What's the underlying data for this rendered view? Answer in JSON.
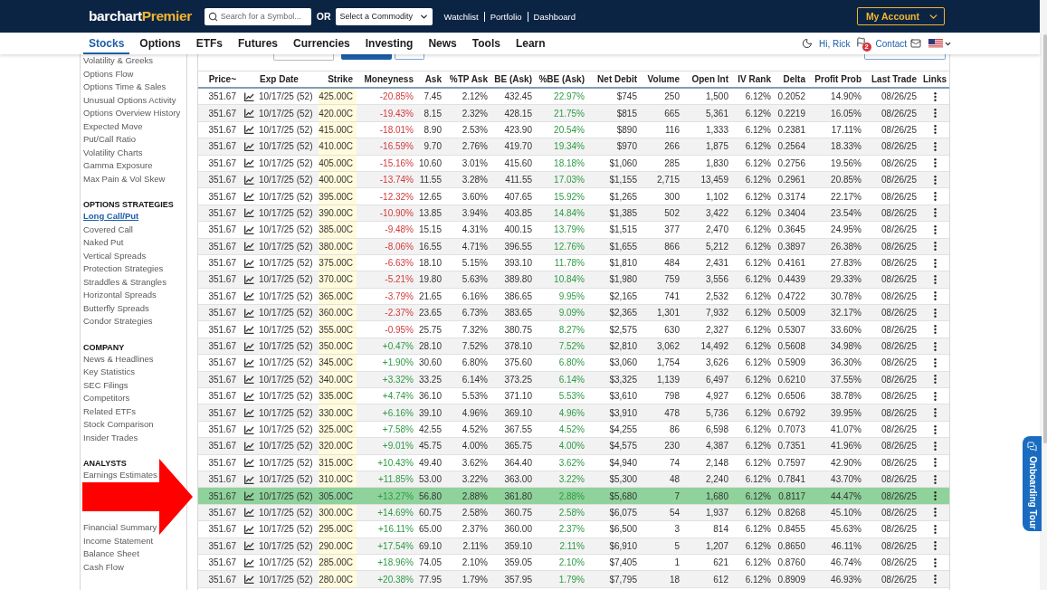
{
  "header": {
    "logo": {
      "brand": "barchart",
      "tier": "Premier"
    },
    "search": {
      "placeholder": "Search for a Symbol..."
    },
    "or_label": "OR",
    "commodity_select": {
      "value": "Select a Commodity"
    },
    "links": [
      "Watchlist",
      "Portfolio",
      "Dashboard"
    ],
    "account_button": "My Account"
  },
  "nav": {
    "tabs": [
      {
        "label": "Stocks",
        "selected": true
      },
      {
        "label": "Options",
        "selected": false
      },
      {
        "label": "ETFs",
        "selected": false
      },
      {
        "label": "Futures",
        "selected": false
      },
      {
        "label": "Currencies",
        "selected": false
      },
      {
        "label": "Investing",
        "selected": false
      },
      {
        "label": "News",
        "selected": false
      },
      {
        "label": "Tools",
        "selected": false
      },
      {
        "label": "Learn",
        "selected": false
      }
    ],
    "greeting": "Hi, Rick",
    "notification_count": "2",
    "contact": "Contact"
  },
  "sidebar": {
    "sections": [
      {
        "items": [
          {
            "kind": "link",
            "label": "Volatility & Greeks",
            "selected": false
          },
          {
            "kind": "link",
            "label": "Options Flow",
            "selected": false
          },
          {
            "kind": "link",
            "label": "Options Time & Sales",
            "selected": false
          },
          {
            "kind": "link",
            "label": "Unusual Options Activity",
            "selected": false
          },
          {
            "kind": "link",
            "label": "Options Overview History",
            "selected": false
          },
          {
            "kind": "link",
            "label": "Expected Move",
            "selected": false
          },
          {
            "kind": "link",
            "label": "Put/Call Ratio",
            "selected": false
          },
          {
            "kind": "link",
            "label": "Volatility Charts",
            "selected": false
          },
          {
            "kind": "link",
            "label": "Gamma Exposure",
            "selected": false
          },
          {
            "kind": "link",
            "label": "Max Pain & Vol Skew",
            "selected": false
          }
        ]
      },
      {
        "heading": "OPTIONS STRATEGIES",
        "items": [
          {
            "kind": "link",
            "label": "Long Call/Put",
            "selected": true
          },
          {
            "kind": "link",
            "label": "Covered Call",
            "selected": false
          },
          {
            "kind": "link",
            "label": "Naked Put",
            "selected": false
          },
          {
            "kind": "link",
            "label": "Vertical Spreads",
            "selected": false
          },
          {
            "kind": "link",
            "label": "Protection Strategies",
            "selected": false
          },
          {
            "kind": "link",
            "label": "Straddles & Strangles",
            "selected": false
          },
          {
            "kind": "link",
            "label": "Horizontal Spreads",
            "selected": false
          },
          {
            "kind": "link",
            "label": "Butterfly Spreads",
            "selected": false
          },
          {
            "kind": "link",
            "label": "Condor Strategies",
            "selected": false
          }
        ]
      },
      {
        "heading": "COMPANY",
        "items": [
          {
            "kind": "link",
            "label": "News & Headlines",
            "selected": false
          },
          {
            "kind": "link",
            "label": "Key Statistics",
            "selected": false
          },
          {
            "kind": "link",
            "label": "SEC Filings",
            "selected": false
          },
          {
            "kind": "link",
            "label": "Competitors",
            "selected": false
          },
          {
            "kind": "link",
            "label": "Related ETFs",
            "selected": false
          },
          {
            "kind": "link",
            "label": "Stock Comparison",
            "selected": false
          },
          {
            "kind": "link",
            "label": "Insider Trades",
            "selected": false
          }
        ]
      },
      {
        "heading": "ANALYSTS",
        "items": [
          {
            "kind": "link",
            "label": "Earnings Estimates",
            "selected": false
          },
          {
            "kind": "arrow"
          },
          {
            "kind": "link",
            "label": "Financial Summary",
            "selected": false
          },
          {
            "kind": "link",
            "label": "Income Statement",
            "selected": false
          },
          {
            "kind": "link",
            "label": "Balance Sheet",
            "selected": false
          },
          {
            "kind": "link",
            "label": "Cash Flow",
            "selected": false
          }
        ]
      }
    ]
  },
  "table": {
    "columns": [
      "Price~",
      "Exp Date",
      "Strike",
      "Moneyness",
      "Ask",
      "%TP Ask",
      "BE (Ask)",
      "%BE (Ask)",
      "Net Debit",
      "Volume",
      "Open Int",
      "IV Rank",
      "Delta",
      "Profit Prob",
      "Last Trade",
      "Links"
    ],
    "rows": [
      {
        "cells": [
          "351.67",
          "10/17/25 (52)",
          "425.00C",
          "-20.85%",
          "7.45",
          "2.12%",
          "432.45",
          "22.97%",
          "$745",
          "250",
          "1,500",
          "6.12%",
          "0.2052",
          "14.90%",
          "08/26/25"
        ],
        "in_the_money": false,
        "selected": false
      },
      {
        "cells": [
          "351.67",
          "10/17/25 (52)",
          "420.00C",
          "-19.43%",
          "8.15",
          "2.32%",
          "428.15",
          "21.75%",
          "$815",
          "665",
          "5,361",
          "6.12%",
          "0.2219",
          "16.05%",
          "08/26/25"
        ],
        "in_the_money": false,
        "selected": false
      },
      {
        "cells": [
          "351.67",
          "10/17/25 (52)",
          "415.00C",
          "-18.01%",
          "8.90",
          "2.53%",
          "423.90",
          "20.54%",
          "$890",
          "116",
          "1,333",
          "6.12%",
          "0.2381",
          "17.11%",
          "08/26/25"
        ],
        "in_the_money": false,
        "selected": false
      },
      {
        "cells": [
          "351.67",
          "10/17/25 (52)",
          "410.00C",
          "-16.59%",
          "9.70",
          "2.76%",
          "419.70",
          "19.34%",
          "$970",
          "266",
          "1,875",
          "6.12%",
          "0.2564",
          "18.33%",
          "08/26/25"
        ],
        "in_the_money": false,
        "selected": false
      },
      {
        "cells": [
          "351.67",
          "10/17/25 (52)",
          "405.00C",
          "-15.16%",
          "10.60",
          "3.01%",
          "415.60",
          "18.18%",
          "$1,060",
          "285",
          "1,830",
          "6.12%",
          "0.2756",
          "19.56%",
          "08/26/25"
        ],
        "in_the_money": false,
        "selected": false
      },
      {
        "cells": [
          "351.67",
          "10/17/25 (52)",
          "400.00C",
          "-13.74%",
          "11.55",
          "3.28%",
          "411.55",
          "17.03%",
          "$1,155",
          "2,715",
          "13,459",
          "6.12%",
          "0.2961",
          "20.85%",
          "08/26/25"
        ],
        "in_the_money": false,
        "selected": false
      },
      {
        "cells": [
          "351.67",
          "10/17/25 (52)",
          "395.00C",
          "-12.32%",
          "12.65",
          "3.60%",
          "407.65",
          "15.92%",
          "$1,265",
          "300",
          "1,102",
          "6.12%",
          "0.3174",
          "22.17%",
          "08/26/25"
        ],
        "in_the_money": false,
        "selected": false
      },
      {
        "cells": [
          "351.67",
          "10/17/25 (52)",
          "390.00C",
          "-10.90%",
          "13.85",
          "3.94%",
          "403.85",
          "14.84%",
          "$1,385",
          "502",
          "3,422",
          "6.12%",
          "0.3404",
          "23.54%",
          "08/26/25"
        ],
        "in_the_money": false,
        "selected": false
      },
      {
        "cells": [
          "351.67",
          "10/17/25 (52)",
          "385.00C",
          "-9.48%",
          "15.15",
          "4.31%",
          "400.15",
          "13.79%",
          "$1,515",
          "377",
          "2,470",
          "6.12%",
          "0.3645",
          "24.95%",
          "08/26/25"
        ],
        "in_the_money": false,
        "selected": false
      },
      {
        "cells": [
          "351.67",
          "10/17/25 (52)",
          "380.00C",
          "-8.06%",
          "16.55",
          "4.71%",
          "396.55",
          "12.76%",
          "$1,655",
          "866",
          "5,212",
          "6.12%",
          "0.3897",
          "26.38%",
          "08/26/25"
        ],
        "in_the_money": false,
        "selected": false
      },
      {
        "cells": [
          "351.67",
          "10/17/25 (52)",
          "375.00C",
          "-6.63%",
          "18.10",
          "5.15%",
          "393.10",
          "11.78%",
          "$1,810",
          "484",
          "2,431",
          "6.12%",
          "0.4161",
          "27.83%",
          "08/26/25"
        ],
        "in_the_money": false,
        "selected": false
      },
      {
        "cells": [
          "351.67",
          "10/17/25 (52)",
          "370.00C",
          "-5.21%",
          "19.80",
          "5.63%",
          "389.80",
          "10.84%",
          "$1,980",
          "759",
          "3,556",
          "6.12%",
          "0.4439",
          "29.33%",
          "08/26/25"
        ],
        "in_the_money": false,
        "selected": false
      },
      {
        "cells": [
          "351.67",
          "10/17/25 (52)",
          "365.00C",
          "-3.79%",
          "21.65",
          "6.16%",
          "386.65",
          "9.95%",
          "$2,165",
          "741",
          "2,532",
          "6.12%",
          "0.4722",
          "30.78%",
          "08/26/25"
        ],
        "in_the_money": false,
        "selected": false
      },
      {
        "cells": [
          "351.67",
          "10/17/25 (52)",
          "360.00C",
          "-2.37%",
          "23.65",
          "6.73%",
          "383.65",
          "9.09%",
          "$2,365",
          "1,301",
          "7,932",
          "6.12%",
          "0.5009",
          "32.17%",
          "08/26/25"
        ],
        "in_the_money": false,
        "selected": false
      },
      {
        "cells": [
          "351.67",
          "10/17/25 (52)",
          "355.00C",
          "-0.95%",
          "25.75",
          "7.32%",
          "380.75",
          "8.27%",
          "$2,575",
          "630",
          "2,327",
          "6.12%",
          "0.5307",
          "33.60%",
          "08/26/25"
        ],
        "in_the_money": false,
        "selected": false
      },
      {
        "cells": [
          "351.67",
          "10/17/25 (52)",
          "350.00C",
          "+0.47%",
          "28.10",
          "7.52%",
          "378.10",
          "7.52%",
          "$2,810",
          "3,062",
          "14,492",
          "6.12%",
          "0.5608",
          "34.98%",
          "08/26/25"
        ],
        "in_the_money": true,
        "selected": false
      },
      {
        "cells": [
          "351.67",
          "10/17/25 (52)",
          "345.00C",
          "+1.90%",
          "30.60",
          "6.80%",
          "375.60",
          "6.80%",
          "$3,060",
          "1,754",
          "3,626",
          "6.12%",
          "0.5909",
          "36.30%",
          "08/26/25"
        ],
        "in_the_money": true,
        "selected": false
      },
      {
        "cells": [
          "351.67",
          "10/17/25 (52)",
          "340.00C",
          "+3.32%",
          "33.25",
          "6.14%",
          "373.25",
          "6.14%",
          "$3,325",
          "1,139",
          "6,497",
          "6.12%",
          "0.6210",
          "37.55%",
          "08/26/25"
        ],
        "in_the_money": true,
        "selected": false
      },
      {
        "cells": [
          "351.67",
          "10/17/25 (52)",
          "335.00C",
          "+4.74%",
          "36.10",
          "5.53%",
          "371.10",
          "5.53%",
          "$3,610",
          "798",
          "4,927",
          "6.12%",
          "0.6506",
          "38.78%",
          "08/26/25"
        ],
        "in_the_money": true,
        "selected": false
      },
      {
        "cells": [
          "351.67",
          "10/17/25 (52)",
          "330.00C",
          "+6.16%",
          "39.10",
          "4.96%",
          "369.10",
          "4.96%",
          "$3,910",
          "478",
          "5,736",
          "6.12%",
          "0.6792",
          "39.95%",
          "08/26/25"
        ],
        "in_the_money": true,
        "selected": false
      },
      {
        "cells": [
          "351.67",
          "10/17/25 (52)",
          "325.00C",
          "+7.58%",
          "42.55",
          "4.52%",
          "367.55",
          "4.52%",
          "$4,255",
          "86",
          "6,598",
          "6.12%",
          "0.7073",
          "41.07%",
          "08/26/25"
        ],
        "in_the_money": true,
        "selected": false
      },
      {
        "cells": [
          "351.67",
          "10/17/25 (52)",
          "320.00C",
          "+9.01%",
          "45.75",
          "4.00%",
          "365.75",
          "4.00%",
          "$4,575",
          "230",
          "4,387",
          "6.12%",
          "0.7351",
          "41.96%",
          "08/26/25"
        ],
        "in_the_money": true,
        "selected": false
      },
      {
        "cells": [
          "351.67",
          "10/17/25 (52)",
          "315.00C",
          "+10.43%",
          "49.40",
          "3.62%",
          "364.40",
          "3.62%",
          "$4,940",
          "74",
          "2,148",
          "6.12%",
          "0.7597",
          "42.90%",
          "08/26/25"
        ],
        "in_the_money": true,
        "selected": false
      },
      {
        "cells": [
          "351.67",
          "10/17/25 (52)",
          "310.00C",
          "+11.85%",
          "53.00",
          "3.22%",
          "363.00",
          "3.22%",
          "$5,300",
          "48",
          "2,240",
          "6.12%",
          "0.7841",
          "43.70%",
          "08/26/25"
        ],
        "in_the_money": true,
        "selected": false
      },
      {
        "cells": [
          "351.67",
          "10/17/25 (52)",
          "305.00C",
          "+13.27%",
          "56.80",
          "2.88%",
          "361.80",
          "2.88%",
          "$5,680",
          "7",
          "1,680",
          "6.12%",
          "0.8117",
          "44.47%",
          "08/26/25"
        ],
        "in_the_money": true,
        "selected": true
      },
      {
        "cells": [
          "351.67",
          "10/17/25 (52)",
          "300.00C",
          "+14.69%",
          "60.75",
          "2.58%",
          "360.75",
          "2.58%",
          "$6,075",
          "54",
          "1,937",
          "6.12%",
          "0.8268",
          "45.10%",
          "08/26/25"
        ],
        "in_the_money": true,
        "selected": false
      },
      {
        "cells": [
          "351.67",
          "10/17/25 (52)",
          "295.00C",
          "+16.11%",
          "65.00",
          "2.37%",
          "360.00",
          "2.37%",
          "$6,500",
          "3",
          "814",
          "6.12%",
          "0.8455",
          "45.63%",
          "08/26/25"
        ],
        "in_the_money": true,
        "selected": false
      },
      {
        "cells": [
          "351.67",
          "10/17/25 (52)",
          "290.00C",
          "+17.54%",
          "69.10",
          "2.11%",
          "359.10",
          "2.11%",
          "$6,910",
          "5",
          "1,207",
          "6.12%",
          "0.8650",
          "46.11%",
          "08/26/25"
        ],
        "in_the_money": true,
        "selected": false
      },
      {
        "cells": [
          "351.67",
          "10/17/25 (52)",
          "285.00C",
          "+18.96%",
          "74.05",
          "2.10%",
          "359.05",
          "2.10%",
          "$7,405",
          "1",
          "621",
          "6.12%",
          "0.8760",
          "46.74%",
          "08/26/25"
        ],
        "in_the_money": true,
        "selected": false
      },
      {
        "cells": [
          "351.67",
          "10/17/25 (52)",
          "280.00C",
          "+20.38%",
          "77.95",
          "1.79%",
          "357.95",
          "1.79%",
          "$7,795",
          "18",
          "612",
          "6.12%",
          "0.8909",
          "46.93%",
          "08/26/25"
        ],
        "in_the_money": true,
        "selected": false
      }
    ]
  },
  "onboarding_tab": {
    "label": "Onboarding Tour"
  }
}
